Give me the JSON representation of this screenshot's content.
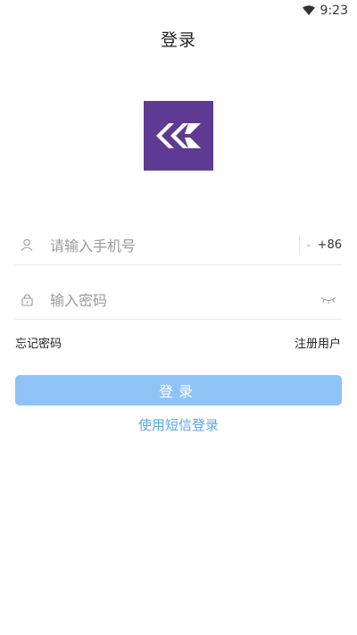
{
  "status_bar": {
    "time": "9:23",
    "icons": [
      "wifi-icon"
    ]
  },
  "header": {
    "title": "登录"
  },
  "logo": {
    "icon": "app-logo",
    "color": "#5e3a93"
  },
  "phone_field": {
    "icon": "user-icon",
    "placeholder": "请输入手机号",
    "country_code": "+86",
    "dropdown_icon": "chevron-down-icon"
  },
  "password_field": {
    "icon": "lock-icon",
    "placeholder": "输入密码",
    "toggle_icon": "eye-closed-icon"
  },
  "links": {
    "forgot": "忘记密码",
    "register": "注册用户"
  },
  "login_button": {
    "label": "登录",
    "color": "#8fc2f6"
  },
  "sms_login": {
    "label": "使用短信登录",
    "color": "#5aa6ec"
  }
}
